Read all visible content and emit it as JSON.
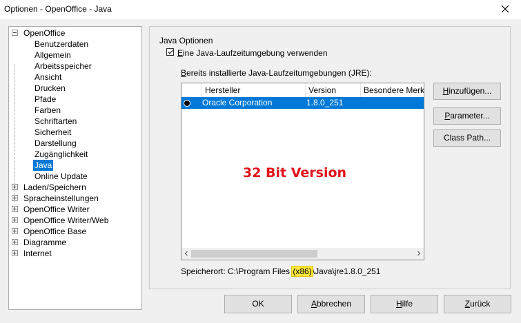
{
  "window": {
    "title": "Optionen - OpenOffice - Java"
  },
  "tree": {
    "root": "OpenOffice",
    "root_children": [
      "Benutzerdaten",
      "Allgemein",
      "Arbeitsspeicher",
      "Ansicht",
      "Drucken",
      "Pfade",
      "Farben",
      "Schriftarten",
      "Sicherheit",
      "Darstellung",
      "Zugänglichkeit",
      "Java",
      "Online Update"
    ],
    "selected": "Java",
    "collapsed_items": [
      "Laden/Speichern",
      "Spracheinstellungen",
      "OpenOffice Writer",
      "OpenOffice Writer/Web",
      "OpenOffice Base",
      "Diagramme",
      "Internet"
    ]
  },
  "java": {
    "group_label": "Java Optionen",
    "use_jre_label_prefix": "",
    "use_jre_label_underlined": "E",
    "use_jre_label_rest": "ine Java-Laufzeitumgebung verwenden",
    "use_jre_checked": true,
    "installed_label_underlined": "B",
    "installed_label_rest": "ereits installierte Java-Laufzeitumgebungen (JRE):",
    "columns": [
      "Hersteller",
      "Version",
      "Besondere Merkmale"
    ],
    "rows": [
      {
        "vendor": "Oracle Corporation",
        "version": "1.8.0_251",
        "features": ""
      }
    ],
    "annotation": "32 Bit Version",
    "location_prefix": "Speicherort: C:\\Program Files ",
    "location_highlight": "(x86)",
    "location_suffix": "\\Java\\jre1.8.0_251",
    "buttons": {
      "add_u": "H",
      "add_rest": "inzufügen...",
      "params_u": "P",
      "params_rest": "arameter...",
      "classpath": "Class Path..."
    }
  },
  "footer": {
    "ok": "OK",
    "cancel_u": "A",
    "cancel_rest": "bbrechen",
    "help_u": "H",
    "help_rest": "ilfe",
    "back_u": "Z",
    "back_rest": "urück"
  }
}
